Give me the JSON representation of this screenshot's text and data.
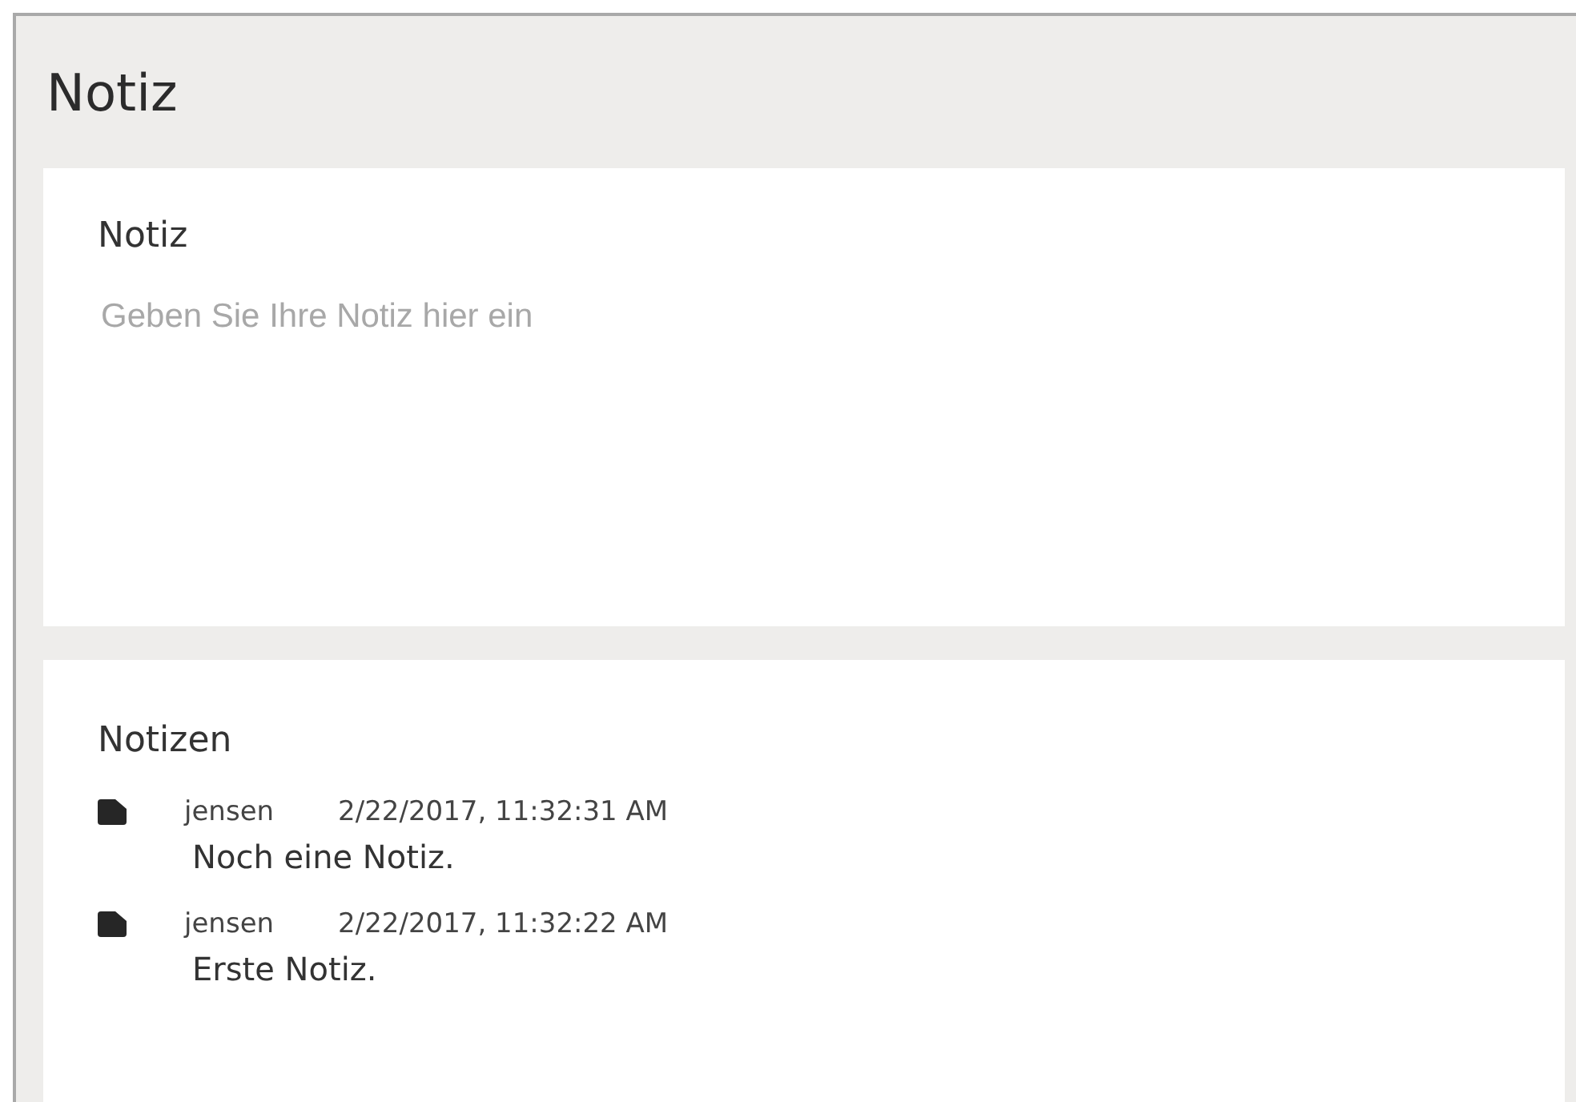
{
  "title": "Notiz",
  "editor": {
    "heading": "Notiz",
    "placeholder": "Geben Sie Ihre Notiz hier ein"
  },
  "notes_list": {
    "heading": "Notizen",
    "notes": [
      {
        "author": "jensen",
        "timestamp": "2/22/2017, 11:32:31 AM",
        "text": "Noch eine Notiz."
      },
      {
        "author": "jensen",
        "timestamp": "2/22/2017, 11:32:22 AM",
        "text": "Erste Notiz."
      }
    ]
  }
}
